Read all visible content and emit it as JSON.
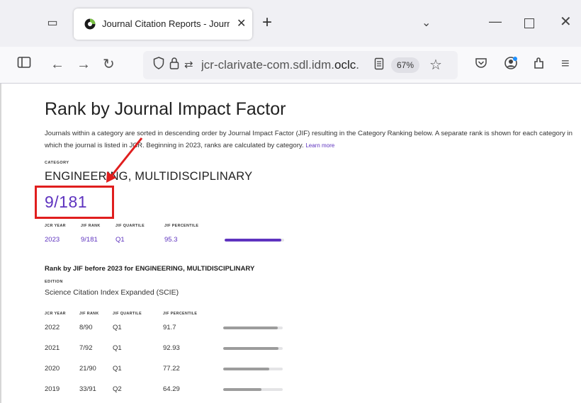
{
  "browser": {
    "tab_title": "Journal Citation Reports - Journ",
    "tab_close": "✕",
    "new_tab": "+",
    "url_host": "jcr-clarivate-com.sdl.idm.",
    "url_host_bold": "oclc",
    "url_tail": ".",
    "zoom": "67%",
    "accent_color": "#5e33bf"
  },
  "page": {
    "title": "Rank by Journal Impact Factor",
    "description": "Journals within a category are sorted in descending order by Journal Impact Factor (JIF) resulting in the Category Ranking below. A separate rank is shown for each category in which the journal is listed in JCR. Beginning in 2023, ranks are calculated by category.",
    "learn_more": "Learn more",
    "category_label": "CATEGORY",
    "category_name": "ENGINEERING, MULTIDISCIPLINARY",
    "category_rank": "9/181",
    "headers": {
      "year": "JCR YEAR",
      "rank": "JIF RANK",
      "quartile": "JIF QUARTILE",
      "percentile": "JIF PERCENTILE"
    },
    "current_row": {
      "year": "2023",
      "rank": "9/181",
      "quartile": "Q1",
      "percentile": "95.3",
      "percentile_value": 95.3
    },
    "before_heading": "Rank by JIF before 2023 for ENGINEERING, MULTIDISCIPLINARY",
    "edition_label": "EDITION",
    "edition_value": "Science Citation Index Expanded (SCIE)",
    "history": [
      {
        "year": "2022",
        "rank": "8/90",
        "quartile": "Q1",
        "percentile": "91.7",
        "percentile_value": 91.7
      },
      {
        "year": "2021",
        "rank": "7/92",
        "quartile": "Q1",
        "percentile": "92.93",
        "percentile_value": 92.93
      },
      {
        "year": "2020",
        "rank": "21/90",
        "quartile": "Q1",
        "percentile": "77.22",
        "percentile_value": 77.22
      },
      {
        "year": "2019",
        "rank": "33/91",
        "quartile": "Q2",
        "percentile": "64.29",
        "percentile_value": 64.29
      }
    ],
    "annotation_color": "#e01e1e"
  }
}
